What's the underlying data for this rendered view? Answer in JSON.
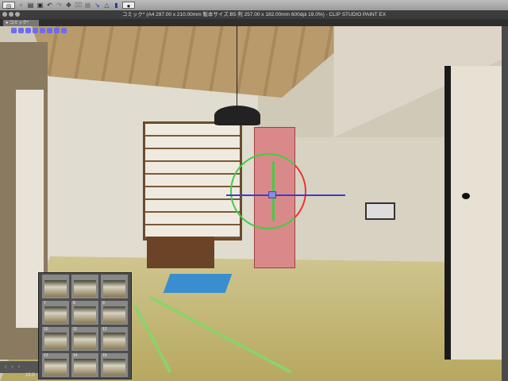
{
  "window": {
    "title": "コミック* (A4 297.00 x 210.00mm 製本サイズ:B5 判 257.00 x 182.00mm 600dpi 19.0%)  - CLIP STUDIO PAINT EX"
  },
  "tab": {
    "label": "● コミック*"
  },
  "thumbnails": [
    {
      "num": ""
    },
    {
      "num": ""
    },
    {
      "num": ""
    },
    {
      "num": "7"
    },
    {
      "num": "8"
    },
    {
      "num": "9"
    },
    {
      "num": "10"
    },
    {
      "num": "11"
    },
    {
      "num": "12"
    },
    {
      "num": "13"
    },
    {
      "num": "14"
    },
    {
      "num": "15"
    }
  ],
  "status": {
    "zoom": "19.0",
    "prev": "‹",
    "next": "›"
  },
  "colors": {
    "accent": "#6c6cf0",
    "gizmo_red": "#e33333",
    "gizmo_green": "#44cc44",
    "gizmo_blue": "#3b3bd0"
  }
}
